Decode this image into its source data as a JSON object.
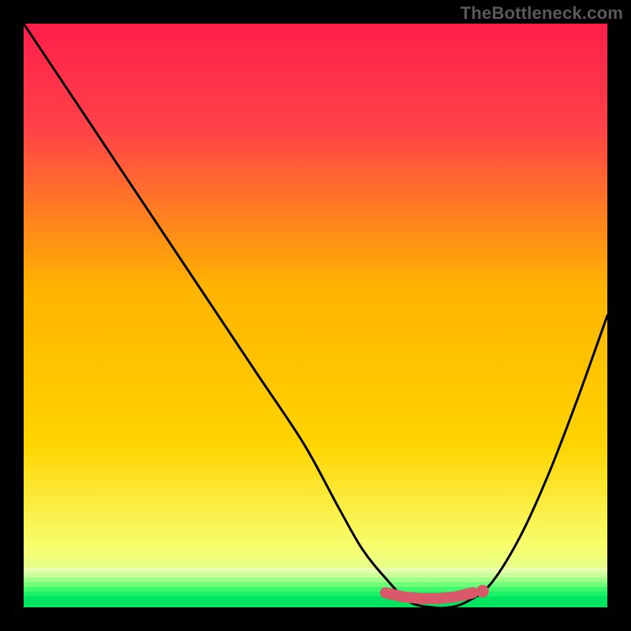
{
  "watermark": "TheBottleneck.com",
  "colors": {
    "frame": "#000000",
    "gradient_top": "#ff1f4a",
    "gradient_mid": "#ffd400",
    "gradient_bottom_strip": "#00e55f",
    "curve": "#000000",
    "marker": "#d9596a",
    "watermark": "#595959"
  },
  "chart_data": {
    "type": "line",
    "title": "",
    "xlabel": "",
    "ylabel": "",
    "xlim": [
      0,
      100
    ],
    "ylim": [
      0,
      100
    ],
    "grid": false,
    "legend": false,
    "series": [
      {
        "name": "bottleneck-curve",
        "x": [
          0,
          8,
          16,
          24,
          32,
          40,
          48,
          54,
          58,
          62,
          66,
          70,
          73,
          76,
          80,
          85,
          90,
          95,
          100
        ],
        "y": [
          100,
          88,
          76,
          64,
          52,
          40,
          28,
          17,
          10,
          5,
          1,
          0,
          0,
          1,
          4,
          12,
          23,
          36,
          50
        ]
      }
    ],
    "highlight": {
      "name": "optimal-range",
      "x": [
        62,
        65,
        68,
        71,
        74,
        77
      ],
      "y": [
        2.5,
        1.8,
        1.5,
        1.5,
        1.8,
        2.5
      ]
    }
  }
}
